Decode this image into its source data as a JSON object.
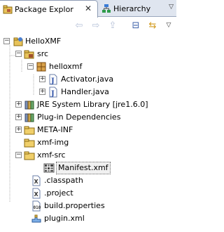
{
  "tabs": {
    "active_label": "Package Explor",
    "inactive_label": "Hierarchy",
    "close_glyph": "✕",
    "view_menu_glyph": "▽"
  },
  "toolbar": {
    "back_glyph": "⇦",
    "forward_glyph": "⇨",
    "up_glyph": "⇪",
    "collapse_glyph": "⊟",
    "link_glyph": "⇆"
  },
  "tree": [
    {
      "label": "HelloXMF",
      "icon": "plugin-project-icon",
      "depth": 0,
      "toggle": "minus"
    },
    {
      "label": "src",
      "icon": "source-folder-icon",
      "depth": 1,
      "toggle": "minus"
    },
    {
      "label": "helloxmf",
      "icon": "package-icon",
      "depth": 2,
      "toggle": "minus"
    },
    {
      "label": "Activator.java",
      "icon": "java-file-icon",
      "depth": 3,
      "toggle": "plus"
    },
    {
      "label": "Handler.java",
      "icon": "java-file-icon",
      "depth": 3,
      "toggle": "plus"
    },
    {
      "label": "JRE System Library [jre1.6.0]",
      "icon": "library-icon",
      "depth": 1,
      "toggle": "plus"
    },
    {
      "label": "Plug-in Dependencies",
      "icon": "library-icon",
      "depth": 1,
      "toggle": "plus"
    },
    {
      "label": "META-INF",
      "icon": "folder-icon",
      "depth": 1,
      "toggle": "plus"
    },
    {
      "label": "xmf-img",
      "icon": "folder-icon",
      "depth": 1,
      "toggle": "none"
    },
    {
      "label": "xmf-src",
      "icon": "folder-icon",
      "depth": 1,
      "toggle": "minus"
    },
    {
      "label": "Manifest.xmf",
      "icon": "xmf-file-icon",
      "depth": 2,
      "toggle": "none",
      "selected": true
    },
    {
      "label": ".classpath",
      "icon": "x-file-icon",
      "depth": 1,
      "toggle": "none"
    },
    {
      "label": ".project",
      "icon": "x-file-icon",
      "depth": 1,
      "toggle": "none"
    },
    {
      "label": "build.properties",
      "icon": "properties-file-icon",
      "depth": 1,
      "toggle": "none"
    },
    {
      "label": "plugin.xml",
      "icon": "plugin-xml-icon",
      "depth": 1,
      "toggle": "none"
    }
  ]
}
